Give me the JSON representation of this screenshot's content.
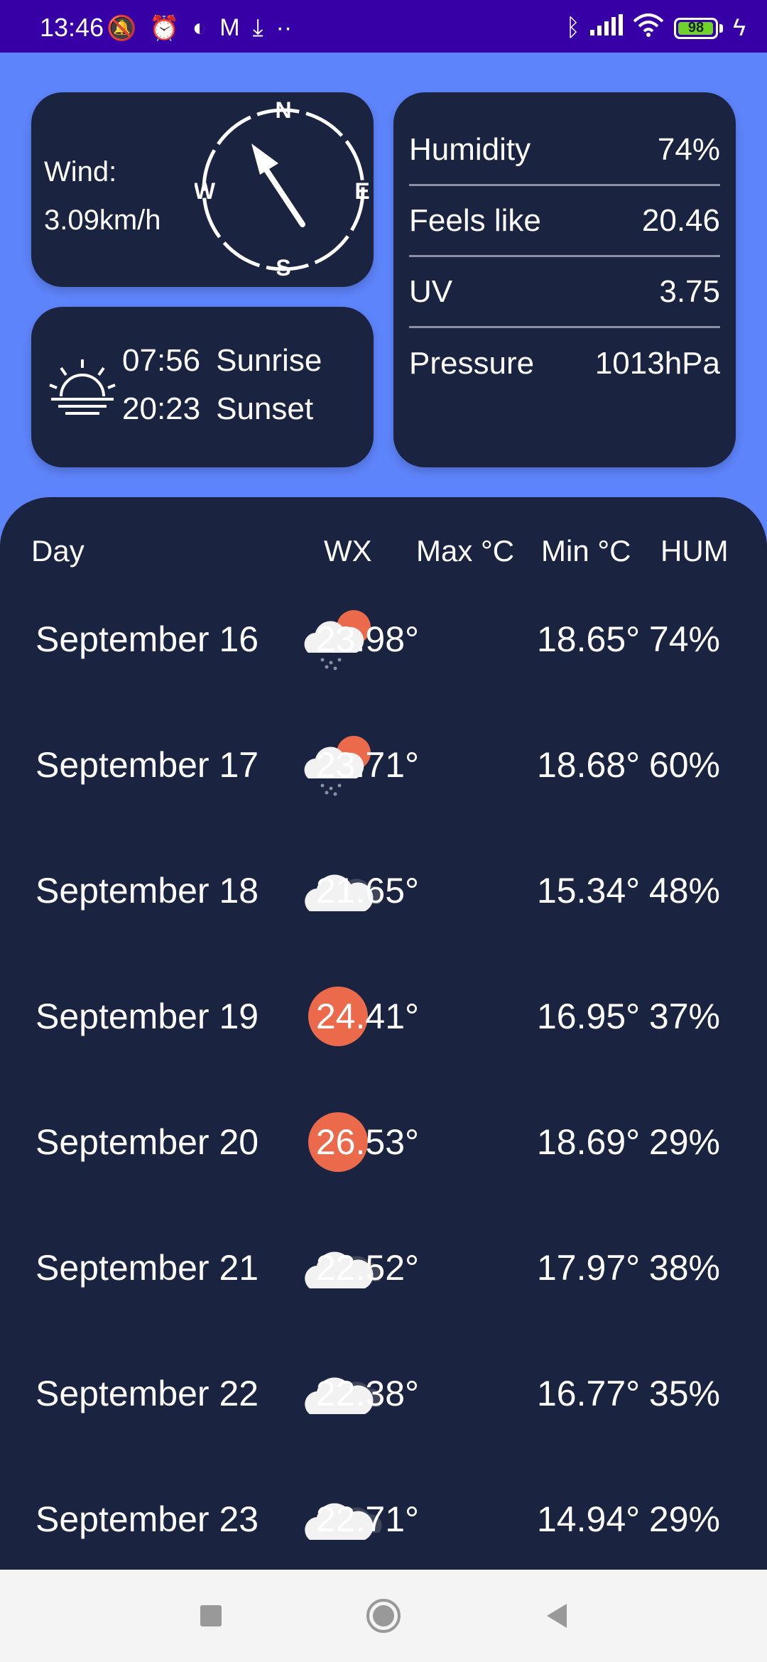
{
  "status_bar": {
    "time": "13:46",
    "battery": "98",
    "left_icons": [
      "mute-icon",
      "alarm-icon",
      "app-icon",
      "gmail-icon",
      "download-icon",
      "more-icon"
    ],
    "right_icons": [
      "bluetooth-icon",
      "signal-icon",
      "wifi-icon",
      "battery-icon",
      "charging-icon"
    ]
  },
  "wind": {
    "label": "Wind:",
    "speed": "3.09km/h",
    "compass": {
      "n": "N",
      "e": "E",
      "s": "S",
      "w": "W"
    }
  },
  "sun": {
    "sunrise_time": "07:56",
    "sunrise_label": "Sunrise",
    "sunset_time": "20:23",
    "sunset_label": "Sunset"
  },
  "stats": [
    {
      "label": "Humidity",
      "value": "74%"
    },
    {
      "label": "Feels like",
      "value": "20.46"
    },
    {
      "label": "UV",
      "value": "3.75"
    },
    {
      "label": "Pressure",
      "value": "1013hPa"
    }
  ],
  "forecast": {
    "headers": {
      "day": "Day",
      "wx": "WX",
      "max": "Max °C",
      "min": "Min °C",
      "hum": "HUM"
    },
    "rows": [
      {
        "day": "September 16",
        "icon": "cloud-rain-sun-icon",
        "max": "23.98°",
        "min": "18.65°",
        "hum": "74%"
      },
      {
        "day": "September 17",
        "icon": "cloud-rain-sun-icon",
        "max": "23.71°",
        "min": "18.68°",
        "hum": "60%"
      },
      {
        "day": "September 18",
        "icon": "cloudy-icon",
        "max": "21.65°",
        "min": "15.34°",
        "hum": "48%"
      },
      {
        "day": "September 19",
        "icon": "sun-icon",
        "max": "24.41°",
        "min": "16.95°",
        "hum": "37%"
      },
      {
        "day": "September 20",
        "icon": "sun-icon",
        "max": "26.53°",
        "min": "18.69°",
        "hum": "29%"
      },
      {
        "day": "September 21",
        "icon": "cloudy-icon",
        "max": "22.52°",
        "min": "17.97°",
        "hum": "38%"
      },
      {
        "day": "September 22",
        "icon": "cloudy-icon",
        "max": "22.38°",
        "min": "16.77°",
        "hum": "35%"
      },
      {
        "day": "September 23",
        "icon": "cloudy-icon",
        "max": "22.71°",
        "min": "14.94°",
        "hum": "29%"
      }
    ]
  },
  "colors": {
    "status_bar": "#3600a6",
    "background": "#5e84fb",
    "card": "#1a2340",
    "sun": "#ec6a4c",
    "battery": "#6fd32a"
  },
  "nav": [
    "recents-button",
    "home-button",
    "back-button"
  ]
}
